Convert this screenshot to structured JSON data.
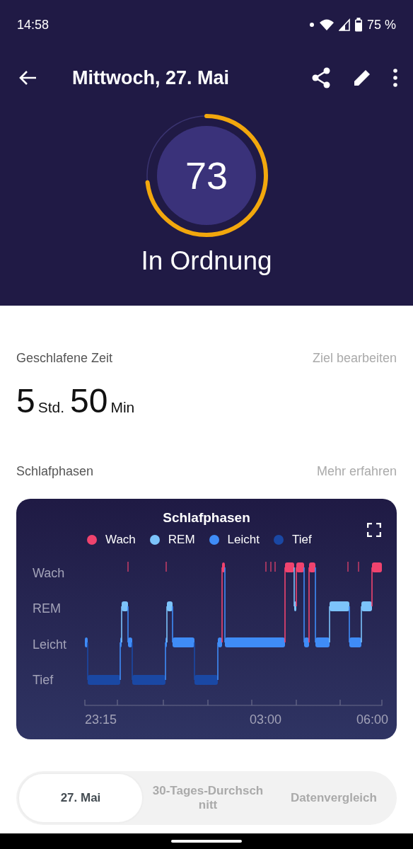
{
  "status_bar": {
    "time": "14:58",
    "battery": "75 %"
  },
  "toolbar": {
    "title": "Mittwoch, 27. Mai"
  },
  "score": {
    "value": "73",
    "level": 0.73,
    "rating": "In Ordnung"
  },
  "sleep_time": {
    "label": "Geschlafene Zeit",
    "link": "Ziel bearbeiten",
    "hours": "5",
    "hours_unit": "Std.",
    "minutes": "50",
    "minutes_unit": "Min"
  },
  "phases": {
    "label": "Schlafphasen",
    "link": "Mehr erfahren",
    "card": {
      "title": "Schlafphasen",
      "legend": [
        {
          "name": "Wach",
          "color": "#f0436e"
        },
        {
          "name": "REM",
          "color": "#7cc3fb"
        },
        {
          "name": "Leicht",
          "color": "#3f8cf7"
        },
        {
          "name": "Tief",
          "color": "#1a48a4"
        }
      ],
      "y_labels": [
        "Wach",
        "REM",
        "Leicht",
        "Tief"
      ],
      "x_labels": [
        "23:15",
        "03:00",
        "06:00"
      ]
    }
  },
  "tabs": [
    {
      "label": "27. Mai",
      "selected": true
    },
    {
      "label": "30-Tages-Durchschnitt",
      "selected": false
    },
    {
      "label": "Datenvergleich",
      "selected": false
    }
  ]
}
